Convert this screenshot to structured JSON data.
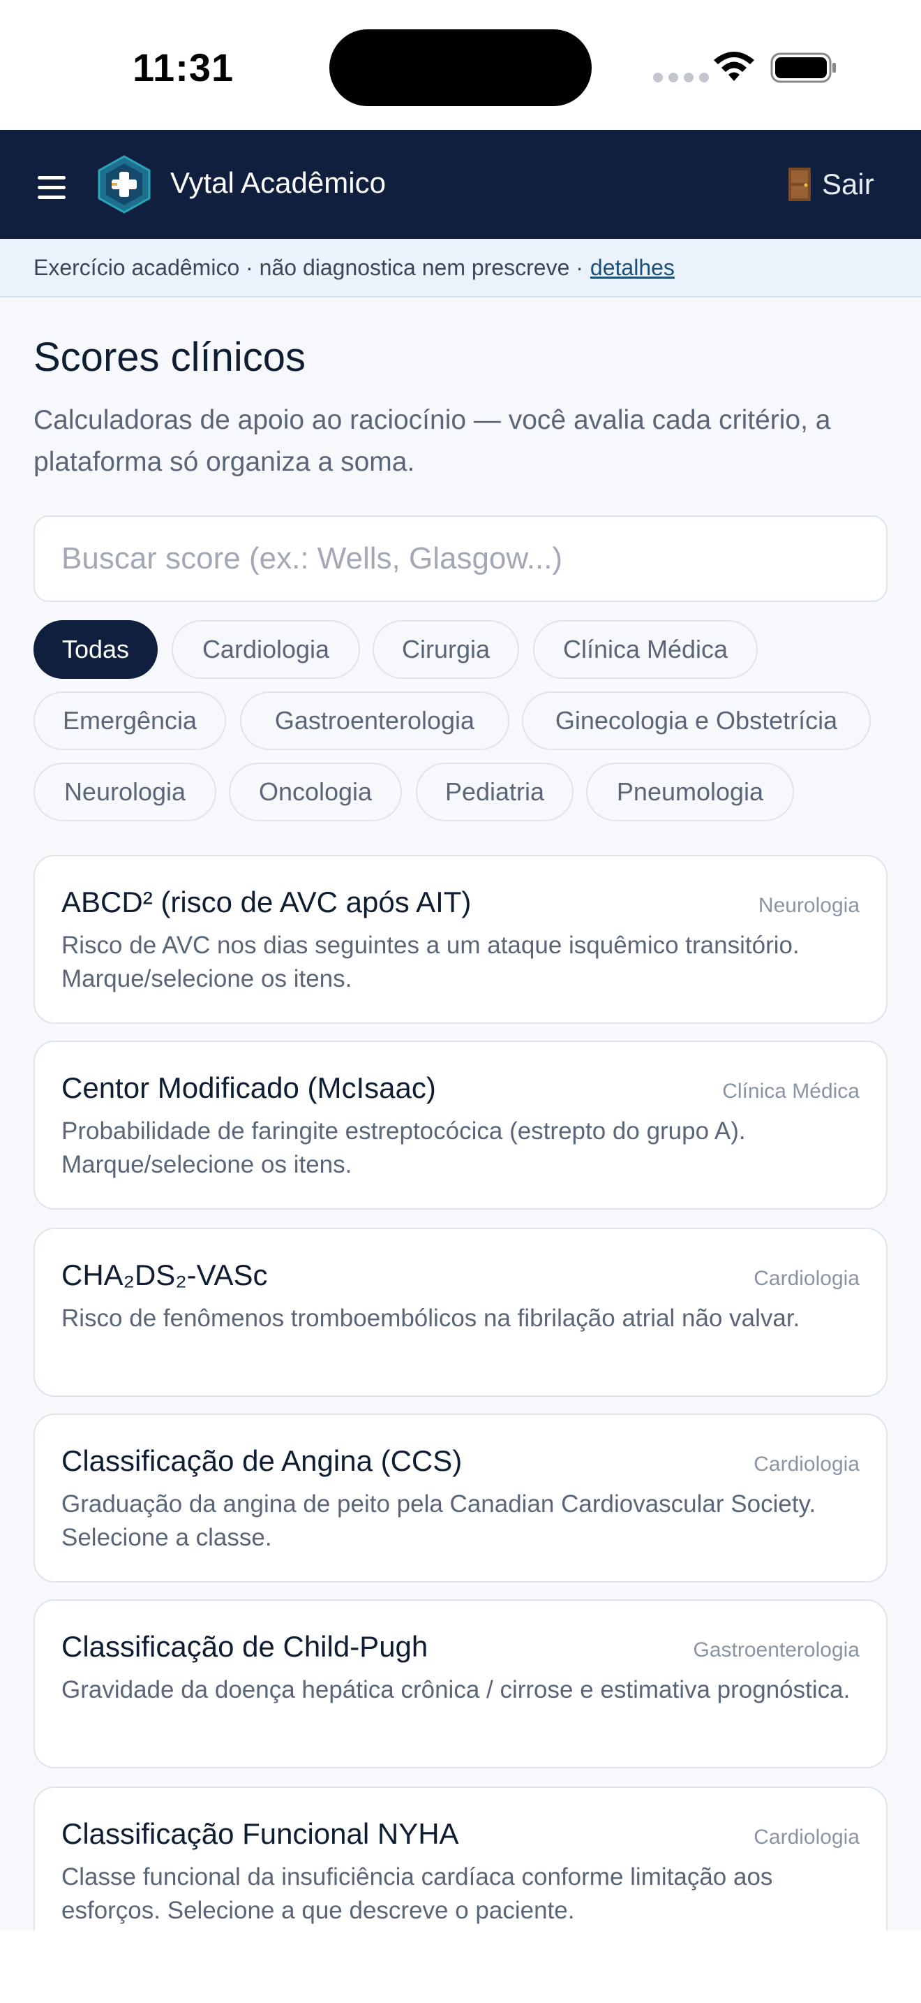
{
  "status_bar": {
    "time": "11:31"
  },
  "header": {
    "app_title": "Vytal Acadêmico",
    "logout_label": "Sair",
    "menu_icon": "hamburger-menu-icon",
    "logo_icon": "medical-cross-hexagon-icon",
    "door_icon": "door-icon",
    "background_color": "#0f1f3d"
  },
  "disclaimer": {
    "text": "Exercício acadêmico · não diagnostica nem prescreve ·",
    "link_label": "detalhes"
  },
  "page": {
    "title": "Scores clínicos",
    "subtitle": "Calculadoras de apoio ao raciocínio — você avalia cada critério, a plataforma só organiza a soma."
  },
  "search": {
    "placeholder": "Buscar score (ex.: Wells, Glasgow...)",
    "value": ""
  },
  "filters": [
    {
      "label": "Todas",
      "active": true
    },
    {
      "label": "Cardiologia",
      "active": false
    },
    {
      "label": "Cirurgia",
      "active": false
    },
    {
      "label": "Clínica Médica",
      "active": false
    },
    {
      "label": "Emergência",
      "active": false
    },
    {
      "label": "Gastroenterologia",
      "active": false
    },
    {
      "label": "Ginecologia e Obstetrícia",
      "active": false
    },
    {
      "label": "Neurologia",
      "active": false
    },
    {
      "label": "Oncologia",
      "active": false
    },
    {
      "label": "Pediatria",
      "active": false
    },
    {
      "label": "Pneumologia",
      "active": false
    }
  ],
  "scores": [
    {
      "title": "ABCD² (risco de AVC após AIT)",
      "category": "Neurologia",
      "description": "Risco de AVC nos dias seguintes a um ataque isquêmico transitório. Marque/selecione os itens."
    },
    {
      "title": "Centor Modificado (McIsaac)",
      "category": "Clínica Médica",
      "description": "Probabilidade de faringite estreptocócica (estrepto do grupo A). Marque/selecione os itens."
    },
    {
      "title": "CHA₂DS₂-VASc",
      "category": "Cardiologia",
      "description": "Risco de fenômenos tromboembólicos na fibrilação atrial não valvar."
    },
    {
      "title": "Classificação de Angina (CCS)",
      "category": "Cardiologia",
      "description": "Graduação da angina de peito pela Canadian Cardiovascular Society. Selecione a classe."
    },
    {
      "title": "Classificação de Child-Pugh",
      "category": "Gastroenterologia",
      "description": "Gravidade da doença hepática crônica / cirrose e estimativa prognóstica."
    },
    {
      "title": "Classificação Funcional NYHA",
      "category": "Cardiologia",
      "description": "Classe funcional da insuficiência cardíaca conforme limitação aos esforços. Selecione a que descreve o paciente."
    }
  ]
}
